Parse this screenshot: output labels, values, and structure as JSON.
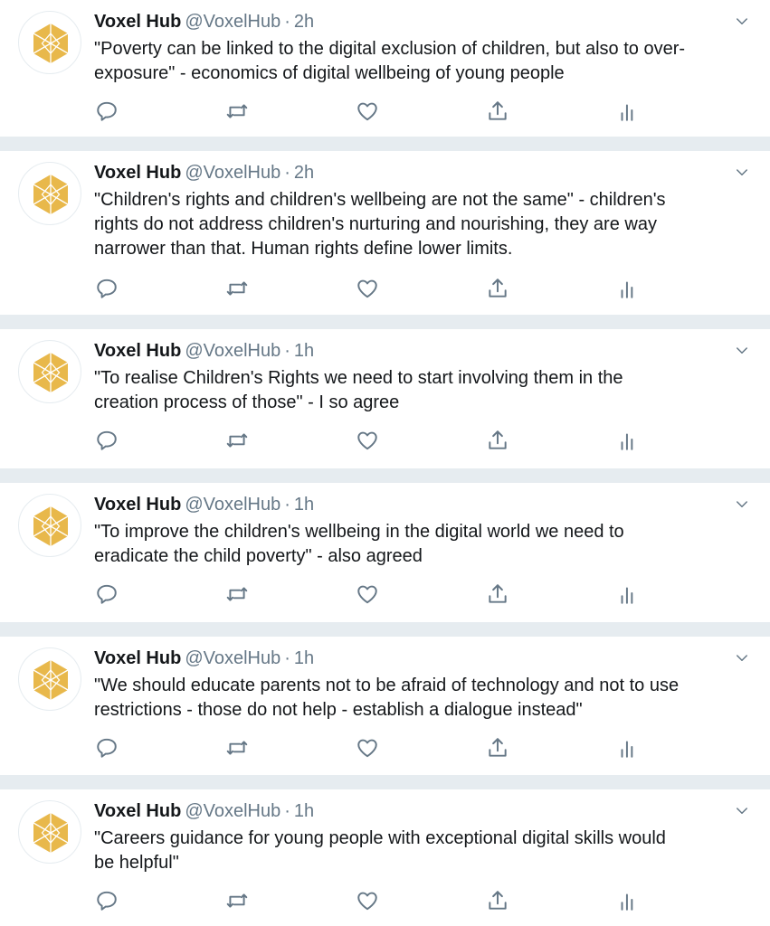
{
  "colors": {
    "icon": "#657786",
    "divider": "#e6ecf0",
    "avatar_fill": "#e8b84b",
    "avatar_lines": "#ffffff"
  },
  "icons": {
    "reply": "reply-icon",
    "retweet": "retweet-icon",
    "like": "heart-icon",
    "share": "share-icon",
    "analytics": "analytics-icon",
    "menu": "chevron-down-icon",
    "avatar": "hexagon-logo"
  },
  "tweets": [
    {
      "name": "Voxel Hub",
      "handle": "@VoxelHub",
      "sep": "·",
      "time": "2h",
      "lines": [
        "\"Poverty can be linked to the digital exclusion of children, but also to over-",
        "exposure\" - economics of digital wellbeing of young people"
      ]
    },
    {
      "name": "Voxel Hub",
      "handle": "@VoxelHub",
      "sep": "·",
      "time": "2h",
      "lines": [
        "\"Children's rights and children's wellbeing are not the same\" - children's",
        "rights do not address children's nurturing and nourishing, they are way",
        "narrower than that. Human rights define lower limits."
      ]
    },
    {
      "name": "Voxel Hub",
      "handle": "@VoxelHub",
      "sep": "·",
      "time": "1h",
      "lines": [
        "\"To realise Children's Rights we need to start involving them in the",
        "creation process of those\" - I so agree"
      ]
    },
    {
      "name": "Voxel Hub",
      "handle": "@VoxelHub",
      "sep": "·",
      "time": "1h",
      "lines": [
        "\"To improve the children's wellbeing in the digital world we need to",
        "eradicate the child poverty\" - also agreed"
      ]
    },
    {
      "name": "Voxel Hub",
      "handle": "@VoxelHub",
      "sep": "·",
      "time": "1h",
      "lines": [
        "\"We should educate parents not to be afraid of technology and not to use",
        "restrictions - those do not help - establish a dialogue instead\""
      ]
    },
    {
      "name": "Voxel Hub",
      "handle": "@VoxelHub",
      "sep": "·",
      "time": "1h",
      "lines": [
        "\"Careers guidance for young people with exceptional digital skills would",
        "be helpful\""
      ]
    }
  ]
}
